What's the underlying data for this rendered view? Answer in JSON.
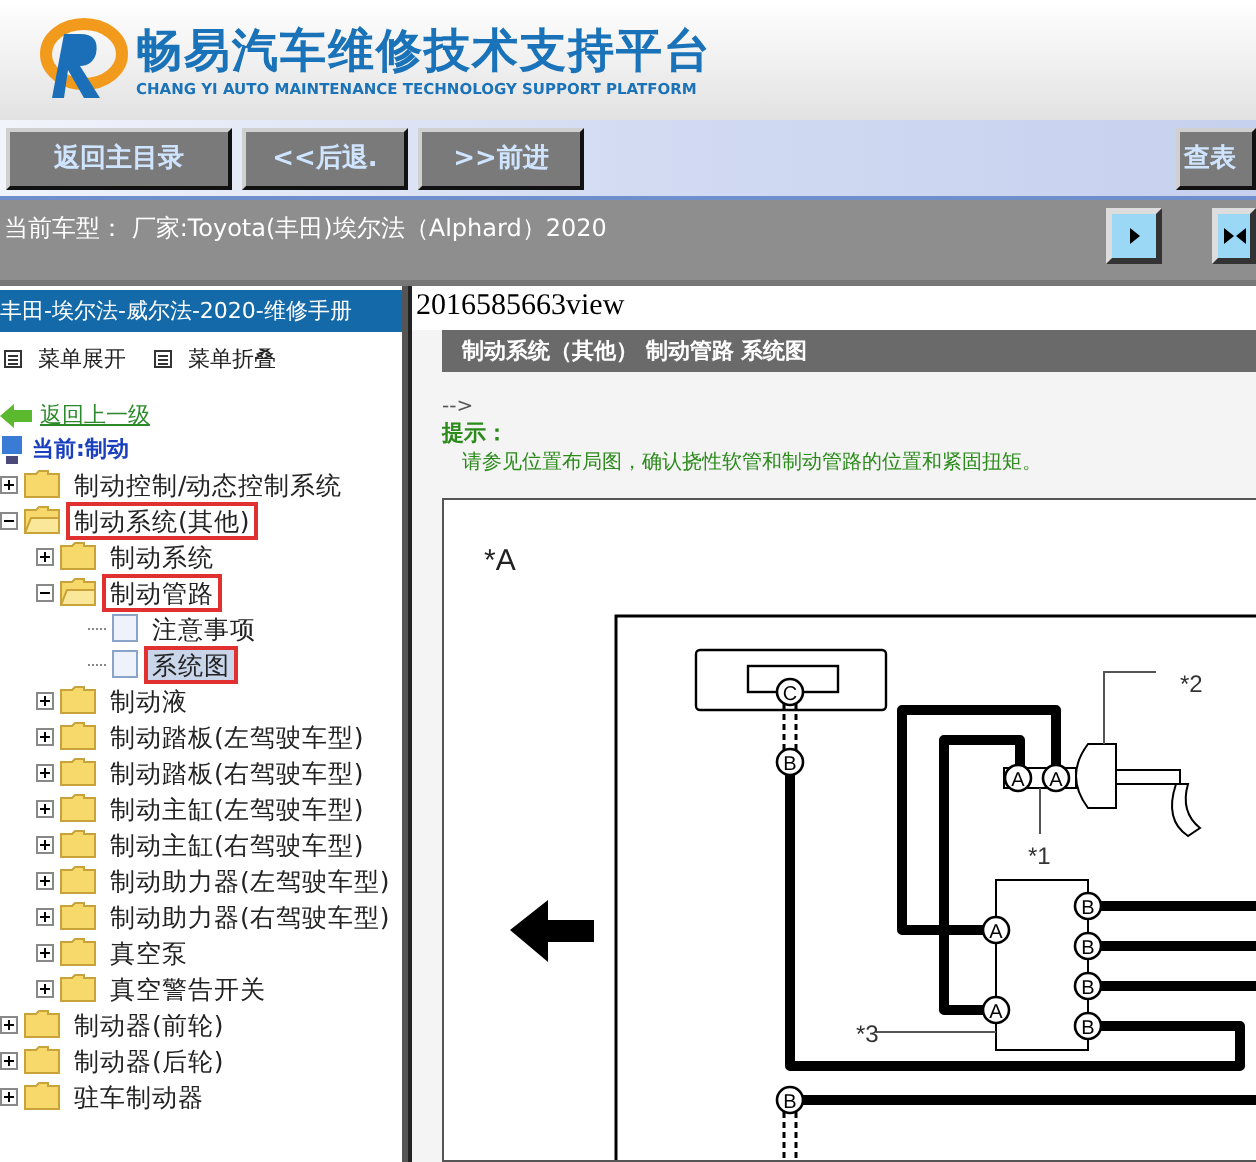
{
  "header": {
    "title": "畅易汽车维修技术支持平台",
    "subtitle": "CHANG YI AUTO MAINTENANCE TECHNOLOGY SUPPORT PLATFORM"
  },
  "toolbar": {
    "buttons": [
      "返回主目录",
      "<<后退.",
      ">>前进"
    ],
    "right_button": "查表"
  },
  "vehicle_bar": {
    "text": "当前车型：  厂家:Toyota(丰田)埃尔法（Alphard）2020"
  },
  "sidebar": {
    "title": "丰田-埃尔法-威尔法-2020-维修手册",
    "expand_all": "菜单展开",
    "collapse_all": "菜单折叠",
    "back_link": "返回上一级",
    "current": "当前:制动",
    "tree": [
      {
        "label": "制动控制/动态控制系统",
        "kind": "folder",
        "expanded": false,
        "selected": false,
        "marked": false
      },
      {
        "label": "制动系统(其他)",
        "kind": "folder",
        "expanded": true,
        "selected": false,
        "marked": true,
        "children": [
          {
            "label": "制动系统",
            "kind": "folder",
            "expanded": false,
            "selected": false,
            "marked": false
          },
          {
            "label": "制动管路",
            "kind": "folder",
            "expanded": true,
            "selected": false,
            "marked": true,
            "children": [
              {
                "label": "注意事项",
                "kind": "page",
                "selected": false,
                "marked": false
              },
              {
                "label": "系统图",
                "kind": "page",
                "selected": true,
                "marked": true
              }
            ]
          },
          {
            "label": "制动液",
            "kind": "folder",
            "expanded": false,
            "selected": false,
            "marked": false
          },
          {
            "label": "制动踏板(左驾驶车型)",
            "kind": "folder",
            "expanded": false,
            "selected": false,
            "marked": false
          },
          {
            "label": "制动踏板(右驾驶车型)",
            "kind": "folder",
            "expanded": false,
            "selected": false,
            "marked": false
          },
          {
            "label": "制动主缸(左驾驶车型)",
            "kind": "folder",
            "expanded": false,
            "selected": false,
            "marked": false
          },
          {
            "label": "制动主缸(右驾驶车型)",
            "kind": "folder",
            "expanded": false,
            "selected": false,
            "marked": false
          },
          {
            "label": "制动助力器(左驾驶车型)",
            "kind": "folder",
            "expanded": false,
            "selected": false,
            "marked": false
          },
          {
            "label": "制动助力器(右驾驶车型)",
            "kind": "folder",
            "expanded": false,
            "selected": false,
            "marked": false
          },
          {
            "label": "真空泵",
            "kind": "folder",
            "expanded": false,
            "selected": false,
            "marked": false
          },
          {
            "label": "真空警告开关",
            "kind": "folder",
            "expanded": false,
            "selected": false,
            "marked": false
          }
        ]
      },
      {
        "label": "制动器(前轮)",
        "kind": "folder",
        "expanded": false,
        "selected": false,
        "marked": false
      },
      {
        "label": "制动器(后轮)",
        "kind": "folder",
        "expanded": false,
        "selected": false,
        "marked": false
      },
      {
        "label": "驻车制动器",
        "kind": "folder",
        "expanded": false,
        "selected": false,
        "marked": false
      }
    ]
  },
  "content": {
    "doc_id": "2016585663view",
    "breadcrumb": "制动系统（其他）  制动管路  系统图",
    "comment": "-->",
    "hint_title": "提示：",
    "hint_text": "请参见位置布局图，确认挠性软管和制动管路的位置和紧固扭矩。",
    "diagram": {
      "label": "*A",
      "callouts": [
        "*1",
        "*2",
        "*3"
      ],
      "connectors": [
        "C",
        "B",
        "A",
        "A",
        "A",
        "A",
        "B",
        "B",
        "B",
        "B",
        "B"
      ]
    }
  }
}
